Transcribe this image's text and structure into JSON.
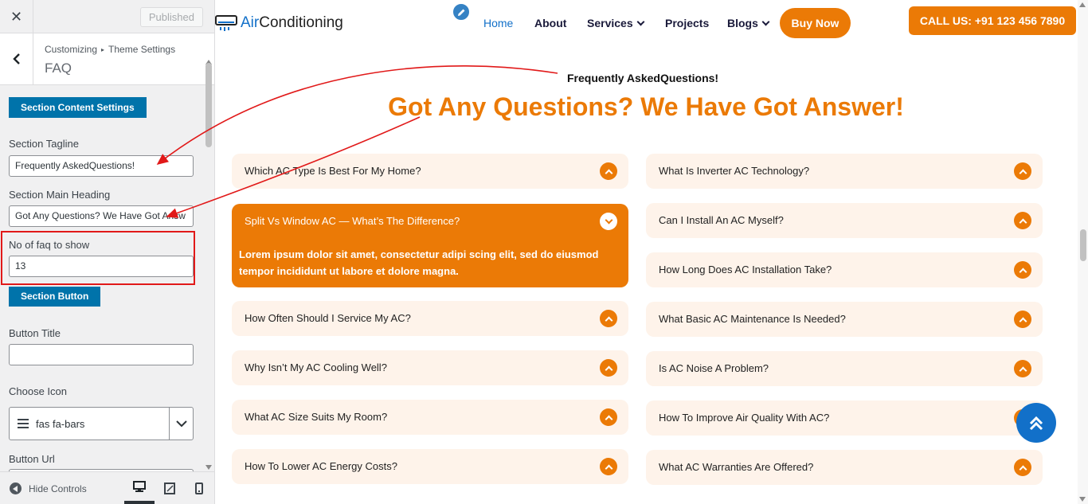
{
  "customizer": {
    "close_label": "✕",
    "published_label": "Published",
    "breadcrumb": [
      "Customizing",
      "Theme Settings"
    ],
    "breadcrumb_sep": "▸",
    "title": "FAQ",
    "section_content_btn": "Section Content Settings",
    "tagline_label": "Section Tagline",
    "tagline_value": "Frequently AskedQuestions!",
    "heading_label": "Section Main Heading",
    "heading_value": "Got Any Questions? We Have Got Answ",
    "faq_count_label": "No of faq to show",
    "faq_count_value": "13",
    "section_button_btn": "Section Button",
    "button_title_label": "Button Title",
    "button_title_value": "",
    "choose_icon_label": "Choose Icon",
    "icon_value": "fas fa-bars",
    "button_url_label": "Button Url",
    "hide_controls_label": "Hide Controls",
    "devices": [
      "desktop-icon",
      "tablet-icon",
      "mobile-icon"
    ]
  },
  "site": {
    "logo_part1": "Air",
    "logo_part2": "Conditioning",
    "nav": [
      "Home",
      "About",
      "Services",
      "Projects",
      "Blogs"
    ],
    "buy_now": "Buy Now",
    "call": "CALL US: +91 123 456 7890",
    "tagline": "Frequently AskedQuestions!",
    "heading": "Got Any Questions? We Have Got Answer!",
    "faq_left": [
      "Which AC Type Is Best For My Home?",
      "Split Vs Window AC — What’s The Difference?",
      "How Often Should I Service My AC?",
      "Why Isn’t My AC Cooling Well?",
      "What AC Size Suits My Room?",
      "How To Lower AC Energy Costs?"
    ],
    "faq_right": [
      "What Is Inverter AC Technology?",
      "Can I Install An AC Myself?",
      "How Long Does AC Installation Take?",
      "What Basic AC Maintenance Is Needed?",
      "Is AC Noise A Problem?",
      "How To Improve Air Quality With AC?",
      "What AC Warranties Are Offered?"
    ],
    "open_answer": "Lorem ipsum dolor sit amet, consectetur adipi scing elit, sed do eiusmod tempor incididunt ut labore et dolore magna.",
    "colors": {
      "accent": "#eb7a06",
      "primary": "#1270c9",
      "faq_bg": "#fef3ea",
      "wp_blue": "#0073aa",
      "annotation": "#e11919"
    }
  }
}
